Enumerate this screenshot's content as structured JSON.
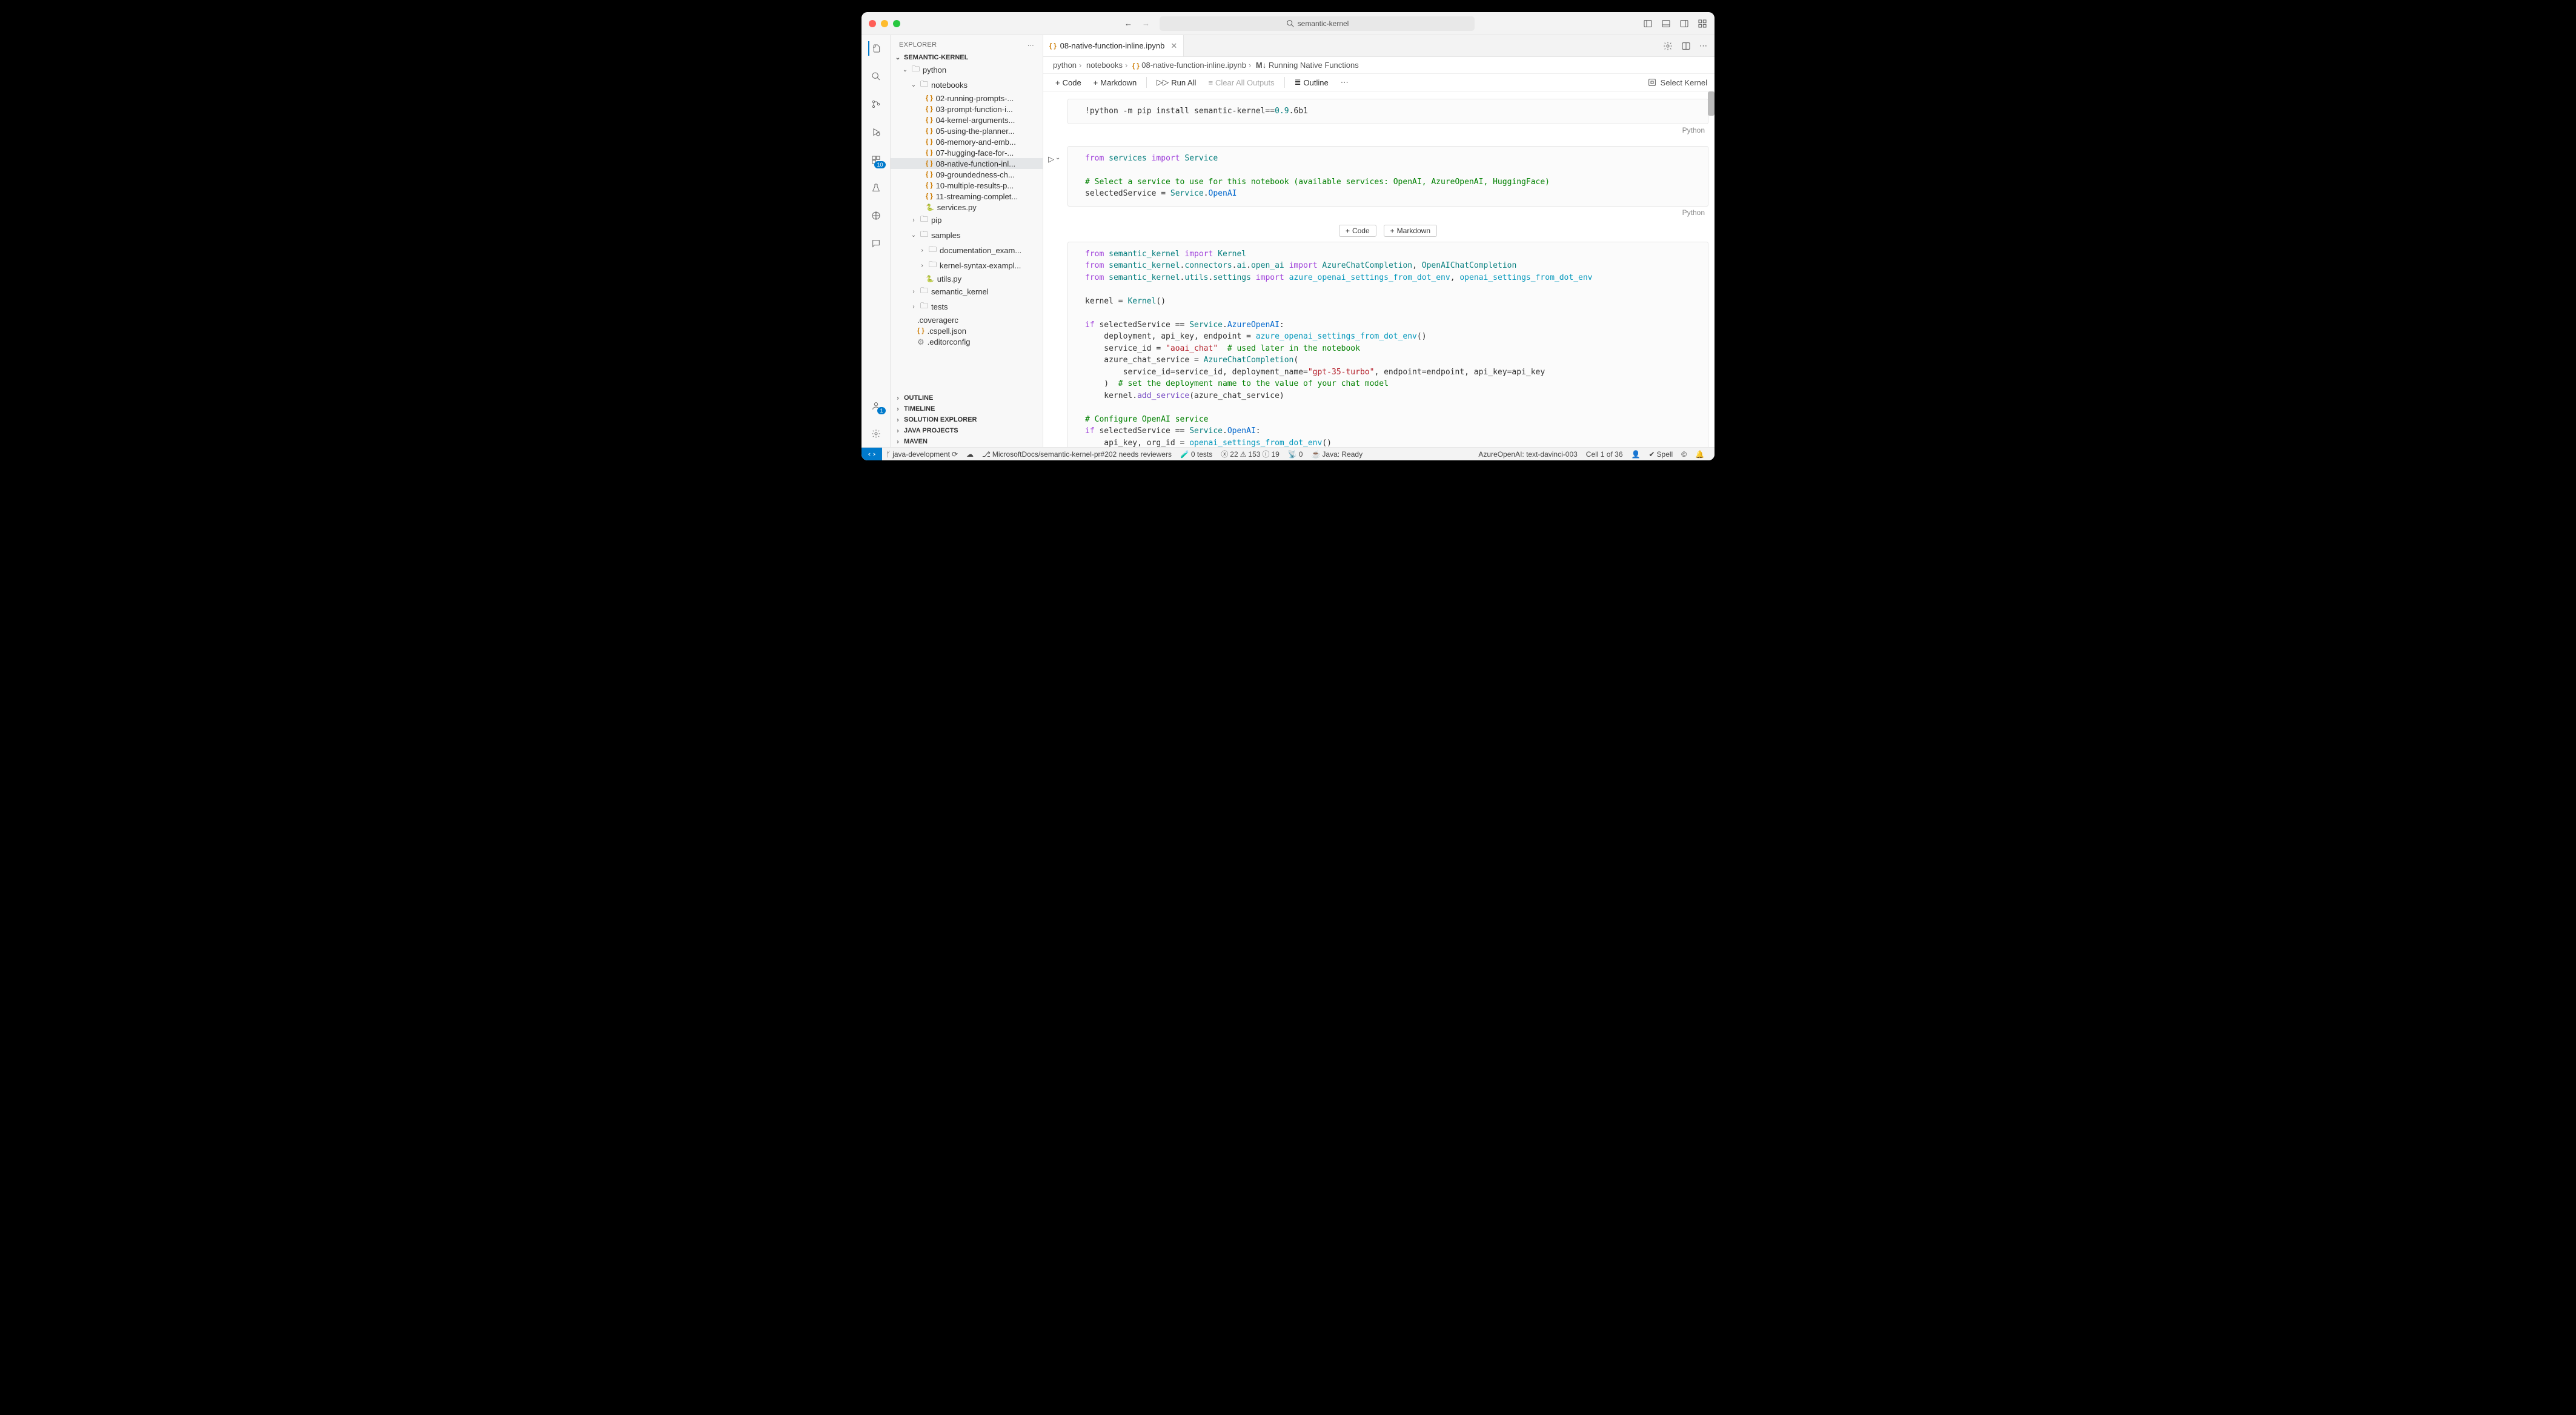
{
  "window": {
    "search_text": "semantic-kernel"
  },
  "sidebar": {
    "title": "EXPLORER",
    "project": "SEMANTIC-KERNEL",
    "tree": {
      "python": "python",
      "notebooks": "notebooks",
      "files": [
        "02-running-prompts-...",
        "03-prompt-function-i...",
        "04-kernel-arguments...",
        "05-using-the-planner...",
        "06-memory-and-emb...",
        "07-hugging-face-for-...",
        "08-native-function-inl...",
        "09-groundedness-ch...",
        "10-multiple-results-p...",
        "11-streaming-complet..."
      ],
      "services_py": "services.py",
      "pip": "pip",
      "samples": "samples",
      "doc_exam": "documentation_exam...",
      "kernel_syntax": "kernel-syntax-exampl...",
      "utils_py": "utils.py",
      "semantic_kernel": "semantic_kernel",
      "tests": "tests",
      "coveragerc": ".coveragerc",
      "cspell": ".cspell.json",
      "editorconfig": ".editorconfig"
    },
    "panels": {
      "outline": "OUTLINE",
      "timeline": "TIMELINE",
      "solution": "SOLUTION EXPLORER",
      "java": "JAVA PROJECTS",
      "maven": "MAVEN"
    }
  },
  "tab": {
    "filename": "08-native-function-inline.ipynb"
  },
  "breadcrumb": {
    "p1": "python",
    "p2": "notebooks",
    "p3": "08-native-function-inline.ipynb",
    "p4": "Running Native Functions"
  },
  "toolbar": {
    "code": "Code",
    "markdown": "Markdown",
    "run_all": "Run All",
    "clear": "Clear All Outputs",
    "outline": "Outline",
    "select_kernel": "Select Kernel"
  },
  "insert": {
    "code": "Code",
    "markdown": "Markdown"
  },
  "cell_lang": "Python",
  "statusbar": {
    "branch": "java-development",
    "pr": "MicrosoftDocs/semantic-kernel-pr#202 needs reviewers",
    "tests": "0 tests",
    "errors": "22",
    "warnings": "153",
    "info": "19",
    "radio": "0",
    "java": "Java: Ready",
    "azure": "AzureOpenAI: text-davinci-003",
    "cell": "Cell 1 of 36",
    "spell": "Spell"
  },
  "badges": {
    "ext": "10",
    "account": "1"
  }
}
